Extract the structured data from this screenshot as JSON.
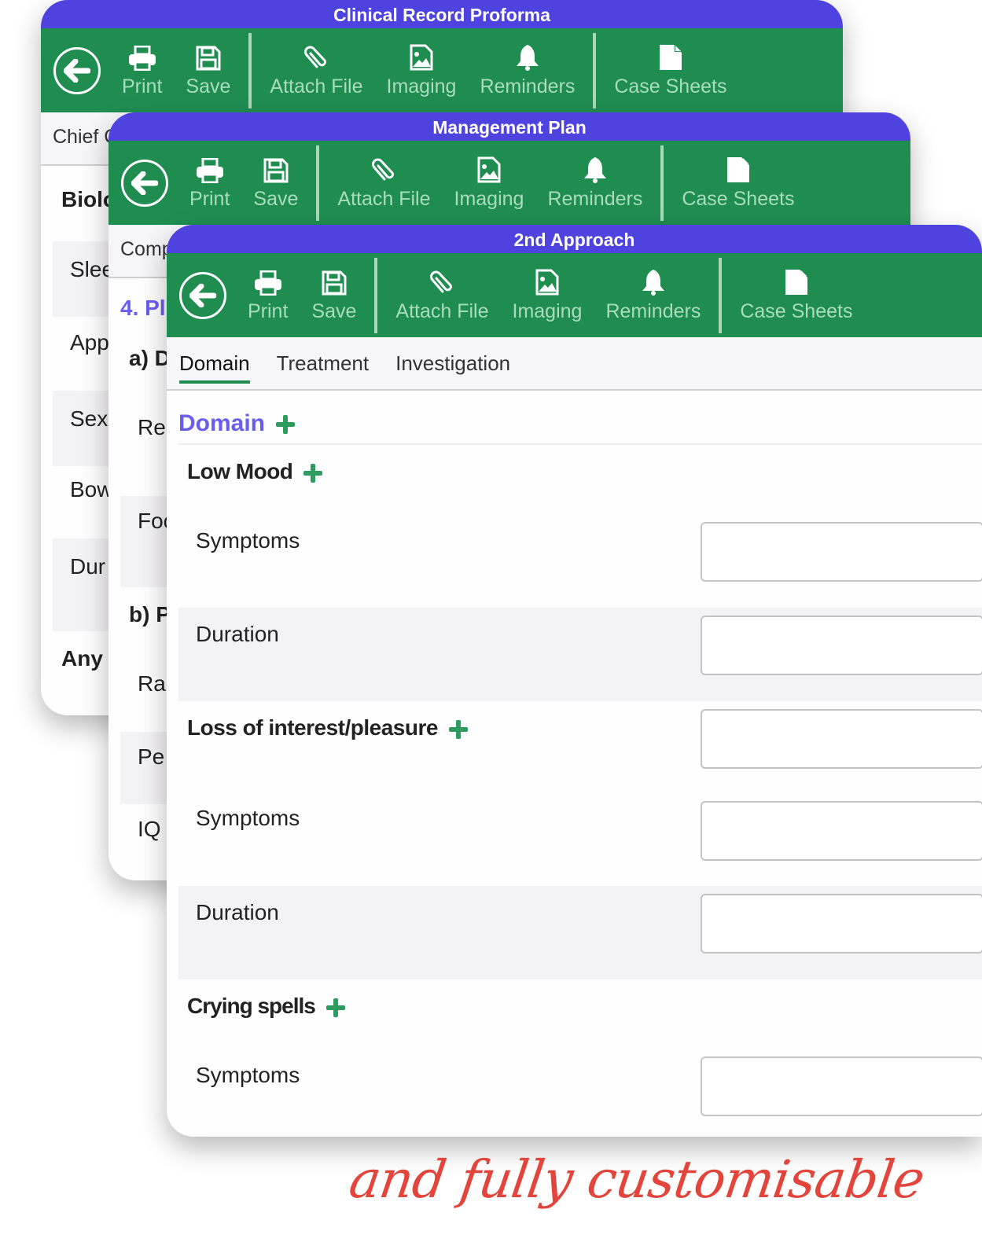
{
  "colors": {
    "title_bar": "#4f43e0",
    "toolbar": "#1f8d50",
    "toolbar_label": "#a9dcbc",
    "accent_purple": "#6b5cf0",
    "plus_green": "#2e9b5f",
    "tagline_red": "#e2453b"
  },
  "toolbar_buttons": [
    {
      "label": "Print",
      "icon": "printer-icon"
    },
    {
      "label": "Save",
      "icon": "floppy-disk-icon"
    },
    {
      "label": "Attach File",
      "icon": "paperclip-icon"
    },
    {
      "label": "Imaging",
      "icon": "image-file-icon"
    },
    {
      "label": "Reminders",
      "icon": "bell-icon"
    },
    {
      "label": "Case Sheets",
      "icon": "document-icon"
    }
  ],
  "panel1": {
    "title": "Clinical Record Proforma",
    "subheader": "Chief C",
    "rows": [
      "Biolo",
      "Slee",
      "App",
      "Sexu",
      "Bow",
      "Dur",
      "Any C"
    ]
  },
  "panel2": {
    "title": "Management Plan",
    "subheader": "Comp",
    "section": "4. Pl",
    "rows": [
      "a) D",
      "Re",
      "Foc",
      "b) P",
      "Ra",
      "Pe",
      "IQ"
    ]
  },
  "panel3": {
    "title": "2nd Approach",
    "tabs": [
      "Domain",
      "Treatment",
      "Investigation"
    ],
    "active_tab": "Domain",
    "section_title": "Domain",
    "groups": [
      {
        "title": "Low Mood",
        "fields": [
          "Symptoms",
          "Duration"
        ]
      },
      {
        "title": "Loss of interest/pleasure",
        "fields": [
          "Symptoms",
          "Duration"
        ]
      },
      {
        "title": "Crying spells",
        "fields": [
          "Symptoms"
        ]
      }
    ]
  },
  "tagline": "and fully customisable"
}
